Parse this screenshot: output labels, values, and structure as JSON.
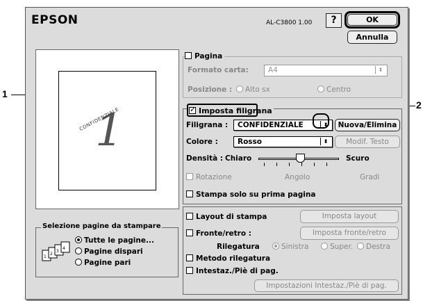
{
  "dialog": {
    "logo": "EPSON",
    "model": "AL-C3800 1.00",
    "help_label": "?",
    "ok_label": "OK",
    "cancel_label": "Annulla"
  },
  "preview": {
    "page_number": "1",
    "watermark_text": "CONFIDENZIALE"
  },
  "page_setup": {
    "title": "Pagina",
    "paper_label": "Formato carta:",
    "paper_value": "A4",
    "position_label": "Posizione :",
    "position_options": [
      "Alto sx",
      "Centro"
    ]
  },
  "watermark": {
    "checkbox_label": "Imposta filigrana",
    "filigrana_label": "Filigrana :",
    "filigrana_value": "CONFIDENZIALE",
    "new_delete_label": "Nuova/Elimina",
    "color_label": "Colore :",
    "color_value": "Rosso",
    "edit_text_label": "Modif. Testo",
    "density_label": "Densità :",
    "density_min": "Chiaro",
    "density_max": "Scuro",
    "rotation_label": "Rotazione",
    "angle_label": "Angolo",
    "degrees_label": "Gradi",
    "first_page_label": "Stampa solo su prima pagina"
  },
  "page_selection": {
    "title": "Selezione pagine da stampare",
    "options": [
      "Tutte le pagine...",
      "Pagine dispari",
      "Pagine pari"
    ],
    "selected_index": 0
  },
  "layout": {
    "layout_label": "Layout di stampa",
    "layout_button": "Imposta layout",
    "duplex_label": "Fronte/retro :",
    "duplex_button": "Imposta fronte/retro",
    "binding_label": "Rilegatura",
    "binding_options": [
      "Sinistra",
      "Super.",
      "Destra"
    ],
    "binding_method_label": "Metodo rilegatura",
    "header_footer_label": "Intestaz./Piè di pag.",
    "header_footer_button": "Impostazioni Intestaz./Piè di pag."
  },
  "callouts": {
    "one": "1",
    "two": "2"
  }
}
